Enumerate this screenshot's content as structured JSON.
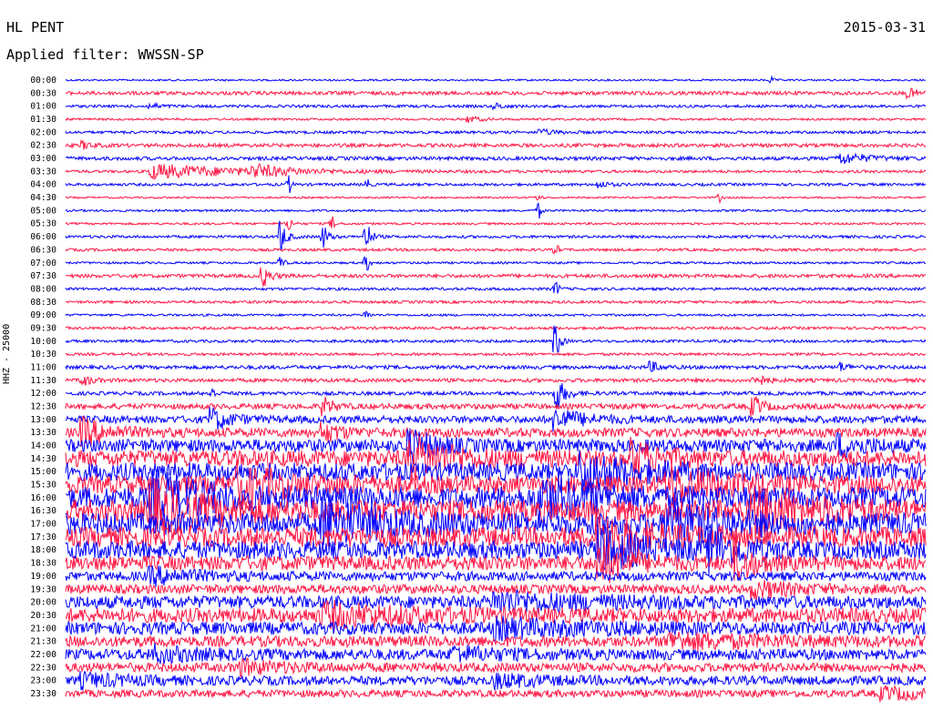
{
  "header": {
    "station": "HL PENT",
    "date": "2015-03-31",
    "filter_label": "Applied filter: WWSSN-SP"
  },
  "chart_data": {
    "type": "line",
    "title": "HL PENT",
    "subtitle": "Applied filter: WWSSN-SP",
    "ylabel": "HHZ - 25000",
    "colors": [
      "#0000ff",
      "#ff1744"
    ],
    "rows": [
      {
        "time": "00:00",
        "noise": 1,
        "events": [
          [
            0.82,
            4,
            0.003
          ]
        ]
      },
      {
        "time": "00:30",
        "noise": 2,
        "events": [
          [
            0.98,
            5,
            0.01
          ]
        ]
      },
      {
        "time": "01:00",
        "noise": 1.5,
        "events": [
          [
            0.1,
            3,
            0.01
          ],
          [
            0.5,
            3,
            0.01
          ]
        ]
      },
      {
        "time": "01:30",
        "noise": 1.2,
        "events": [
          [
            0.47,
            4,
            0.01
          ]
        ]
      },
      {
        "time": "02:00",
        "noise": 1.5,
        "events": [
          [
            0.55,
            3,
            0.02
          ]
        ]
      },
      {
        "time": "02:30",
        "noise": 2,
        "events": [
          [
            0.02,
            4,
            0.01
          ]
        ]
      },
      {
        "time": "03:00",
        "noise": 2,
        "events": [
          [
            0.9,
            6,
            0.03
          ]
        ]
      },
      {
        "time": "03:30",
        "noise": 1.5,
        "events": [
          [
            0.1,
            8,
            0.1
          ],
          [
            0.22,
            6,
            0.03
          ]
        ]
      },
      {
        "time": "04:00",
        "noise": 1.5,
        "events": [
          [
            0.26,
            12,
            0.002
          ],
          [
            0.35,
            10,
            0.002
          ],
          [
            0.62,
            4,
            0.01
          ]
        ]
      },
      {
        "time": "04:30",
        "noise": 1,
        "events": [
          [
            0.55,
            8,
            0.002
          ],
          [
            0.76,
            6,
            0.002
          ]
        ]
      },
      {
        "time": "05:00",
        "noise": 1.2,
        "events": [
          [
            0.55,
            12,
            0.002
          ]
        ]
      },
      {
        "time": "05:30",
        "noise": 1.2,
        "events": [
          [
            0.26,
            10,
            0.003
          ],
          [
            0.31,
            8,
            0.003
          ]
        ]
      },
      {
        "time": "06:00",
        "noise": 1.5,
        "events": [
          [
            0.25,
            20,
            0.006
          ],
          [
            0.3,
            14,
            0.005
          ],
          [
            0.35,
            18,
            0.005
          ]
        ]
      },
      {
        "time": "06:30",
        "noise": 1.5,
        "events": [
          [
            0.57,
            12,
            0.002
          ]
        ]
      },
      {
        "time": "07:00",
        "noise": 1.2,
        "events": [
          [
            0.25,
            10,
            0.003
          ],
          [
            0.35,
            12,
            0.003
          ]
        ]
      },
      {
        "time": "07:30",
        "noise": 2,
        "events": [
          [
            0.23,
            12,
            0.008
          ]
        ]
      },
      {
        "time": "08:00",
        "noise": 1.5,
        "events": [
          [
            0.57,
            10,
            0.003
          ]
        ]
      },
      {
        "time": "08:30",
        "noise": 1.5,
        "events": []
      },
      {
        "time": "09:00",
        "noise": 1.2,
        "events": [
          [
            0.35,
            10,
            0.002
          ]
        ]
      },
      {
        "time": "09:30",
        "noise": 1.5,
        "events": []
      },
      {
        "time": "10:00",
        "noise": 1.5,
        "events": [
          [
            0.57,
            28,
            0.004
          ]
        ]
      },
      {
        "time": "10:30",
        "noise": 1.5,
        "events": []
      },
      {
        "time": "11:00",
        "noise": 2,
        "events": [
          [
            0.68,
            6,
            0.01
          ],
          [
            0.9,
            5,
            0.01
          ]
        ]
      },
      {
        "time": "11:30",
        "noise": 2,
        "events": [
          [
            0.02,
            6,
            0.01
          ],
          [
            0.8,
            10,
            0.01
          ]
        ]
      },
      {
        "time": "12:00",
        "noise": 2,
        "events": [
          [
            0.17,
            8,
            0.003
          ],
          [
            0.57,
            20,
            0.01
          ]
        ]
      },
      {
        "time": "12:30",
        "noise": 3,
        "events": [
          [
            0.3,
            10,
            0.01
          ],
          [
            0.8,
            12,
            0.01
          ]
        ]
      },
      {
        "time": "13:00",
        "noise": 4,
        "events": [
          [
            0.17,
            12,
            0.02
          ],
          [
            0.57,
            12,
            0.03
          ]
        ]
      },
      {
        "time": "13:30",
        "noise": 5,
        "events": [
          [
            0.02,
            14,
            0.03
          ],
          [
            0.3,
            10,
            0.02
          ]
        ]
      },
      {
        "time": "14:00",
        "noise": 7,
        "events": [
          [
            0.4,
            16,
            0.03
          ],
          [
            0.9,
            10,
            0.03
          ]
        ]
      },
      {
        "time": "14:30",
        "noise": 9,
        "events": [
          [
            0.4,
            20,
            0.05
          ],
          [
            0.66,
            18,
            0.03
          ]
        ]
      },
      {
        "time": "15:00",
        "noise": 10,
        "events": [
          [
            0.6,
            20,
            0.05
          ]
        ]
      },
      {
        "time": "15:30",
        "noise": 10,
        "events": [
          [
            0.2,
            20,
            0.05
          ],
          [
            0.7,
            20,
            0.05
          ]
        ]
      },
      {
        "time": "16:00",
        "noise": 12,
        "events": [
          [
            0.1,
            22,
            0.06
          ],
          [
            0.55,
            22,
            0.06
          ]
        ]
      },
      {
        "time": "16:30",
        "noise": 12,
        "events": [
          [
            0.1,
            22,
            0.06
          ],
          [
            0.8,
            22,
            0.06
          ]
        ]
      },
      {
        "time": "17:00",
        "noise": 12,
        "events": [
          [
            0.3,
            22,
            0.06
          ],
          [
            0.7,
            22,
            0.06
          ]
        ]
      },
      {
        "time": "17:30",
        "noise": 11,
        "events": [
          [
            0.62,
            22,
            0.05
          ]
        ]
      },
      {
        "time": "18:00",
        "noise": 10,
        "events": [
          [
            0.62,
            20,
            0.05
          ],
          [
            0.75,
            18,
            0.03
          ]
        ]
      },
      {
        "time": "18:30",
        "noise": 8,
        "events": [
          [
            0.62,
            22,
            0.03
          ],
          [
            0.78,
            20,
            0.02
          ]
        ]
      },
      {
        "time": "19:00",
        "noise": 5,
        "events": [
          [
            0.1,
            8,
            0.05
          ]
        ]
      },
      {
        "time": "19:30",
        "noise": 5,
        "events": [
          [
            0.8,
            8,
            0.05
          ]
        ]
      },
      {
        "time": "20:00",
        "noise": 7,
        "events": [
          [
            0.5,
            9,
            0.1
          ]
        ]
      },
      {
        "time": "20:30",
        "noise": 8,
        "events": [
          [
            0.3,
            10,
            0.1
          ]
        ]
      },
      {
        "time": "21:00",
        "noise": 7,
        "events": [
          [
            0.5,
            8,
            0.1
          ]
        ]
      },
      {
        "time": "21:30",
        "noise": 6,
        "events": [
          [
            0.7,
            8,
            0.1
          ]
        ]
      },
      {
        "time": "22:00",
        "noise": 6,
        "events": [
          [
            0.1,
            7,
            0.05
          ],
          [
            0.45,
            7,
            0.05
          ]
        ]
      },
      {
        "time": "22:30",
        "noise": 5,
        "events": [
          [
            0.2,
            7,
            0.05
          ]
        ]
      },
      {
        "time": "23:00",
        "noise": 5,
        "events": [
          [
            0.02,
            6,
            0.05
          ],
          [
            0.5,
            6,
            0.05
          ]
        ]
      },
      {
        "time": "23:30",
        "noise": 4,
        "events": [
          [
            0.95,
            6,
            0.05
          ]
        ]
      }
    ]
  }
}
